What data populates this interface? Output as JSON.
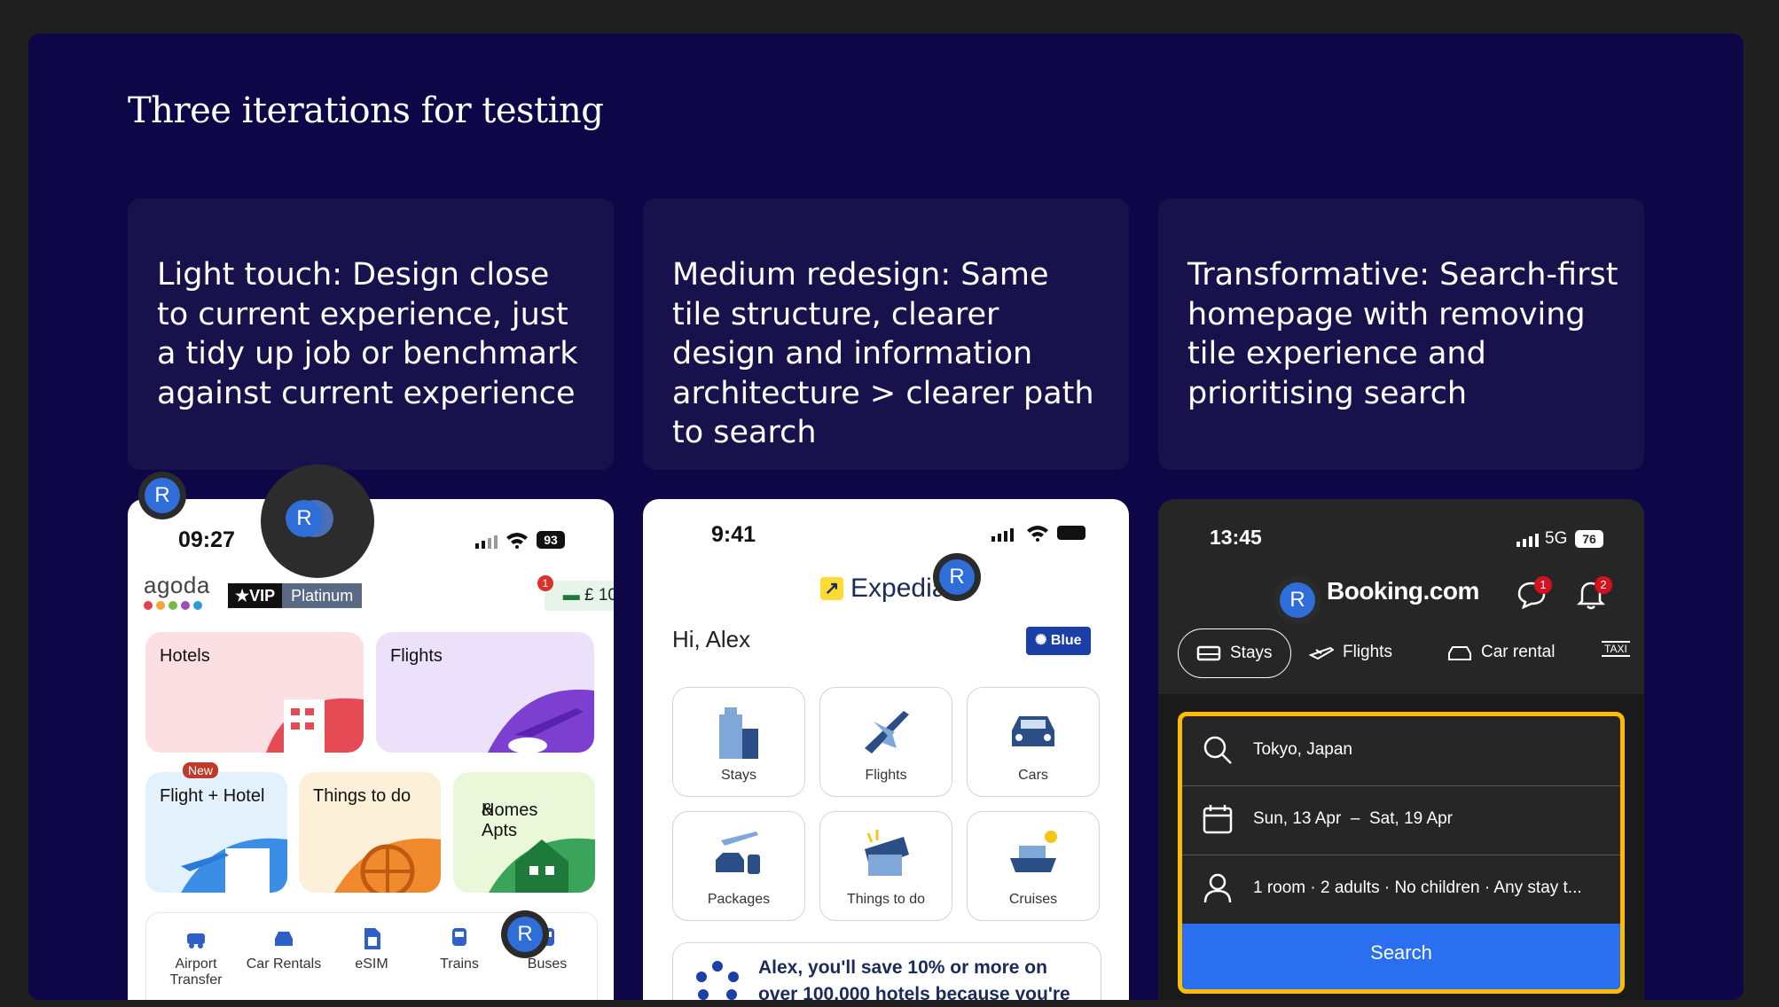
{
  "slide": {
    "title": "Three iterations for testing"
  },
  "cards": [
    {
      "text": "Light touch: Design close to current experience, just a tidy up job or benchmark against current experience"
    },
    {
      "text": "Medium redesign: Same tile structure, clearer design and information architecture > clearer path to search"
    },
    {
      "text": "Transformative: Search-first homepage with removing tile experience and prioritising search"
    }
  ],
  "avatar_letter": "R",
  "agoda": {
    "time": "09:27",
    "battery": "93",
    "logo": "agoda",
    "vip": "★VIP",
    "tier": "Platinum",
    "notification_count": "1",
    "wallet": "£ 10",
    "tiles": [
      "Hotels",
      "Flights",
      "Flight + Hotel",
      "Things to do",
      "Homes\n& Apts"
    ],
    "homes_line1": "Homes",
    "homes_line2": "& Apts",
    "new_badge": "New",
    "nav": [
      "Airport Transfer",
      "Car Rentals",
      "eSIM",
      "Trains",
      "Buses"
    ],
    "nav_airport_1": "Airport",
    "nav_airport_2": "Transfer"
  },
  "expedia": {
    "time": "9:41",
    "logo": "Expedia",
    "greeting": "Hi, Alex",
    "tier": "Blue",
    "tiles": [
      "Stays",
      "Flights",
      "Cars",
      "Packages",
      "Things to do",
      "Cruises"
    ],
    "promo_line1": "Alex, you'll save 10% or more on",
    "promo_line2": "over 100,000 hotels because you're"
  },
  "booking": {
    "time": "13:45",
    "network": "5G",
    "battery": "76",
    "logo": "Booking.com",
    "messages_count": "1",
    "bell_count": "2",
    "tabs": [
      "Stays",
      "Flights",
      "Car rental"
    ],
    "destination": "Tokyo, Japan",
    "dates_from": "Sun, 13 Apr",
    "dates_sep": "–",
    "dates_to": "Sat, 19 Apr",
    "guests": "1 room · 2 adults · No children · Any stay t...",
    "search_button": "Search"
  },
  "colors": {
    "slide_bg": "#0d0748",
    "card_bg": "#17124c",
    "booking_accent": "#febb02",
    "booking_blue": "#2a6ff0",
    "expedia_blue": "#1a3fa6",
    "avatar_blue": "#2f6ed8"
  }
}
